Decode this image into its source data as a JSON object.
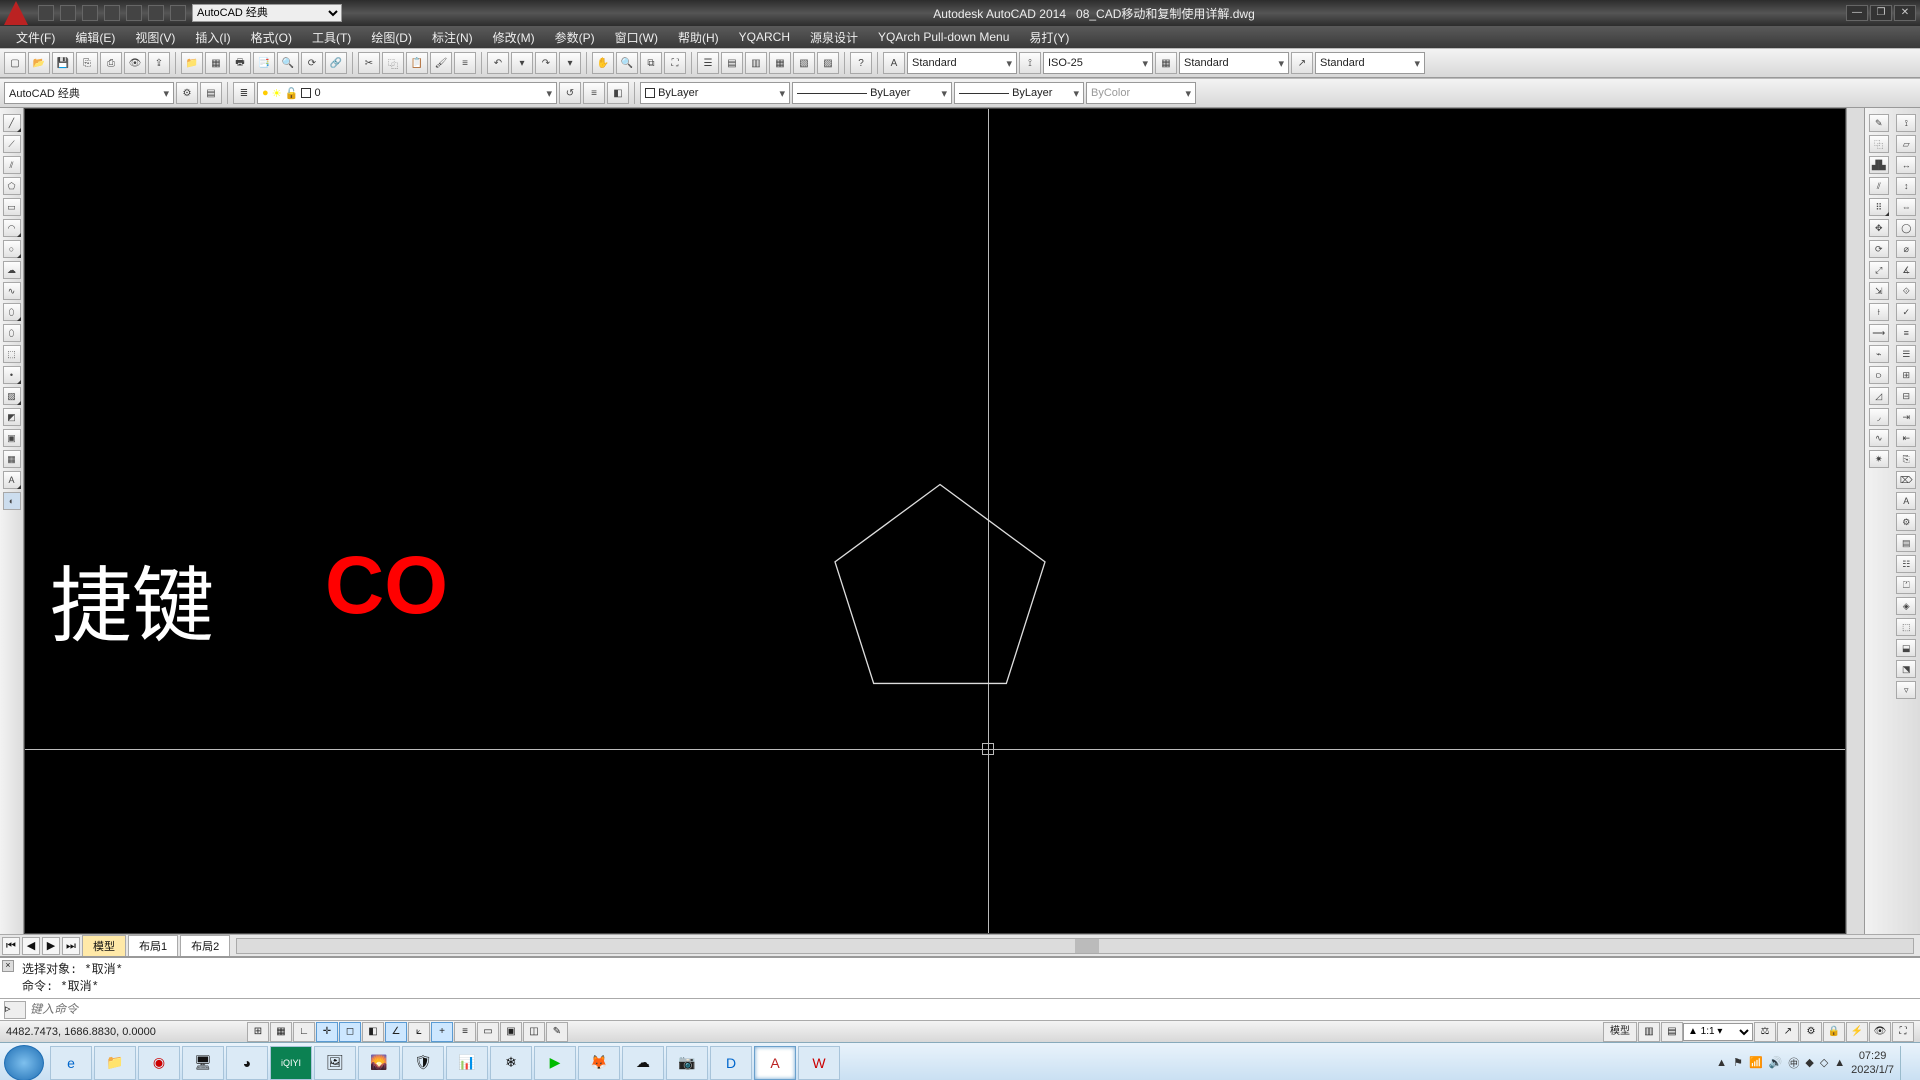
{
  "title": {
    "app": "Autodesk AutoCAD 2014",
    "file": "08_CAD移动和复制使用详解.dwg"
  },
  "workspace_selector": "AutoCAD 经典",
  "menu": [
    "文件(F)",
    "编辑(E)",
    "视图(V)",
    "插入(I)",
    "格式(O)",
    "工具(T)",
    "绘图(D)",
    "标注(N)",
    "修改(M)",
    "参数(P)",
    "窗口(W)",
    "帮助(H)",
    "YQARCH",
    "源泉设计",
    "YQArch Pull-down Menu",
    "易打(Y)"
  ],
  "style_combo1": "Standard",
  "dim_combo": "ISO-25",
  "style_combo2": "Standard",
  "style_combo3": "Standard",
  "workspace2": "AutoCAD 经典",
  "layer_combo": "0",
  "color_combo": "ByLayer",
  "ltype_combo": "ByLayer",
  "lweight_combo": "ByLayer",
  "plotstyle_combo": "ByColor",
  "canvas": {
    "text1": "捷键",
    "text2": "CO"
  },
  "tabs": {
    "model": "模型",
    "layout1": "布局1",
    "layout2": "布局2"
  },
  "command": {
    "line1": "选择对象: *取消*",
    "line2": "命令: *取消*",
    "placeholder": "键入命令"
  },
  "status": {
    "coords": "4482.7473, 1686.8830, 0.0000",
    "right_model": "模型",
    "anno_scale": "1:1"
  },
  "tray": {
    "time": "07:29",
    "date": "2023/1/7"
  }
}
